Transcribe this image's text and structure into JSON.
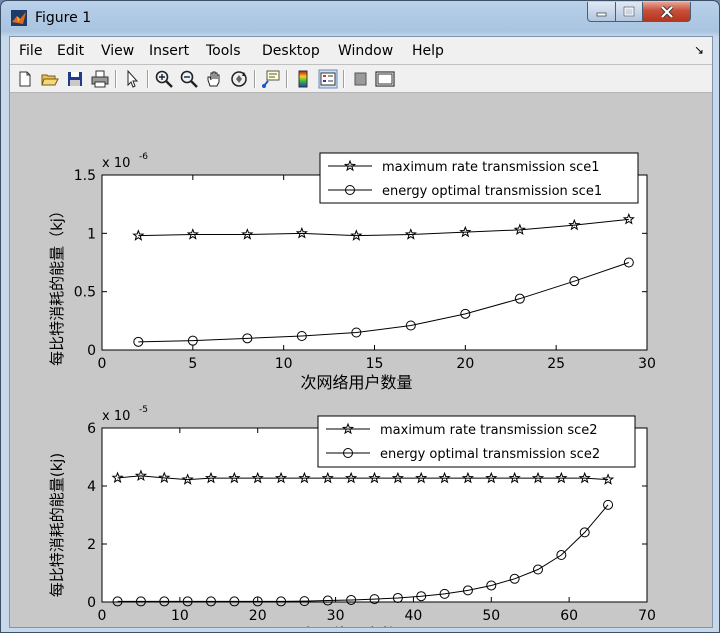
{
  "window": {
    "title": "Figure 1"
  },
  "menu": [
    "File",
    "Edit",
    "View",
    "Insert",
    "Tools",
    "Desktop",
    "Window",
    "Help"
  ],
  "toolbar_icons": [
    "new-figure-icon",
    "open-file-icon",
    "save-icon",
    "print-icon",
    "edit-plot-icon",
    "zoom-in-icon",
    "zoom-out-icon",
    "pan-icon",
    "rotate-3d-icon",
    "data-cursor-icon",
    "insert-colorbar-icon",
    "insert-legend-icon",
    "hide-plot-tools-icon",
    "show-plot-tools-icon"
  ],
  "chart_data": [
    {
      "type": "line",
      "title": "",
      "xlabel": "次网络用户数量",
      "ylabel": "每比特消耗的能量（kj）",
      "exponent_label": "x 10",
      "exponent": "-6",
      "xlim": [
        0,
        30
      ],
      "ylim": [
        0,
        1.5
      ],
      "xticks": [
        "0",
        "5",
        "10",
        "15",
        "20",
        "25",
        "30"
      ],
      "yticks": [
        "0",
        "0.5",
        "1",
        "1.5"
      ],
      "legend_position": "top-right",
      "x": [
        2,
        5,
        8,
        11,
        14,
        17,
        20,
        23,
        26,
        29
      ],
      "series": [
        {
          "name": "maximum rate transmission sce1",
          "marker": "star",
          "values": [
            0.98,
            0.99,
            0.99,
            1.0,
            0.98,
            0.99,
            1.01,
            1.03,
            1.07,
            1.12
          ]
        },
        {
          "name": "energy optimal transmission sce1",
          "marker": "circle",
          "values": [
            0.07,
            0.08,
            0.1,
            0.12,
            0.15,
            0.21,
            0.31,
            0.44,
            0.59,
            0.75
          ]
        }
      ]
    },
    {
      "type": "line",
      "title": "",
      "xlabel": "次网络用户数量",
      "ylabel": "每比特消耗的能量(kj)",
      "exponent_label": "x 10",
      "exponent": "-5",
      "xlim": [
        0,
        70
      ],
      "ylim": [
        0,
        6
      ],
      "xticks": [
        "0",
        "10",
        "20",
        "30",
        "40",
        "50",
        "60",
        "70"
      ],
      "yticks": [
        "0",
        "2",
        "4",
        "6"
      ],
      "legend_position": "top-right",
      "x": [
        2,
        5,
        8,
        11,
        14,
        17,
        20,
        23,
        26,
        29,
        32,
        35,
        38,
        41,
        44,
        47,
        50,
        53,
        56,
        59,
        62,
        65
      ],
      "series": [
        {
          "name": "maximum rate transmission sce2",
          "marker": "star",
          "values": [
            4.28,
            4.35,
            4.28,
            4.22,
            4.27,
            4.27,
            4.27,
            4.27,
            4.27,
            4.27,
            4.27,
            4.27,
            4.27,
            4.27,
            4.27,
            4.27,
            4.27,
            4.27,
            4.27,
            4.27,
            4.27,
            4.22
          ]
        },
        {
          "name": "energy optimal transmission sce2",
          "marker": "circle",
          "values": [
            0.02,
            0.02,
            0.02,
            0.02,
            0.02,
            0.02,
            0.02,
            0.02,
            0.03,
            0.05,
            0.07,
            0.1,
            0.14,
            0.2,
            0.28,
            0.4,
            0.57,
            0.8,
            1.12,
            1.62,
            2.4,
            3.35
          ]
        }
      ]
    }
  ]
}
